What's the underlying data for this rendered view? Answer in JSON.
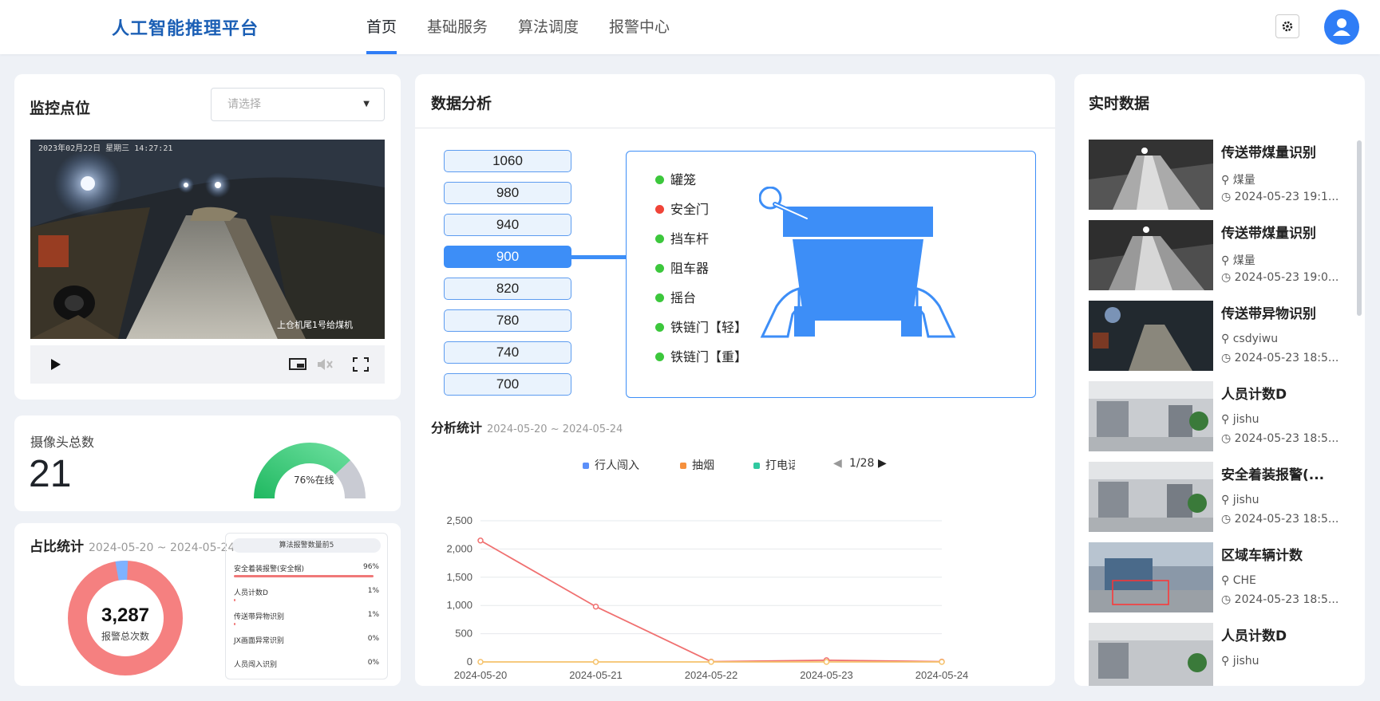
{
  "header": {
    "brand": "人工智能推理平台",
    "nav": [
      "首页",
      "基础服务",
      "算法调度",
      "报警中心"
    ]
  },
  "monitor": {
    "title": "监控点位",
    "select_placeholder": "请选择",
    "video_timestamp": "2023年02月22日 星期三 14:27:21",
    "video_caption": "上仓机尾1号给煤机"
  },
  "camera": {
    "label": "摄像头总数",
    "total": "21",
    "online_percent": 76,
    "online_text": "76%在线"
  },
  "ratio": {
    "title": "占比统计",
    "date_range": "2024-05-20 ~ 2024-05-24",
    "total": "3,287",
    "total_label": "报警总次数",
    "top5_title": "算法报警数量前5",
    "top5": [
      {
        "name": "安全着装报警(安全帽)",
        "pct": "96%",
        "value": 96
      },
      {
        "name": "人员计数D",
        "pct": "1%",
        "value": 1
      },
      {
        "name": "传送带异物识别",
        "pct": "1%",
        "value": 1
      },
      {
        "name": "JX画面异常识别",
        "pct": "0%",
        "value": 0
      },
      {
        "name": "人员闯入识别",
        "pct": "0%",
        "value": 0
      }
    ]
  },
  "analysis": {
    "title": "数据分析",
    "levels": [
      "1060",
      "980",
      "940",
      "900",
      "820",
      "780",
      "740",
      "700"
    ],
    "active_level": "900",
    "statuses": [
      {
        "label": "罐笼",
        "color": "#3cc73c"
      },
      {
        "label": "安全门",
        "color": "#f04438"
      },
      {
        "label": "挡车杆",
        "color": "#3cc73c"
      },
      {
        "label": "阻车器",
        "color": "#3cc73c"
      },
      {
        "label": "摇台",
        "color": "#3cc73c"
      },
      {
        "label": "铁链门【轻】",
        "color": "#3cc73c"
      },
      {
        "label": "铁链门【重】",
        "color": "#3cc73c"
      }
    ],
    "stats_title": "分析统计",
    "stats_range": "2024-05-20 ~ 2024-05-24",
    "legend": [
      {
        "label": "行人闯入",
        "color": "#5b8ff9"
      },
      {
        "label": "抽烟",
        "color": "#f6903d"
      },
      {
        "label": "打电话",
        "color": "#30c9a0"
      }
    ],
    "pager": "1/28"
  },
  "chart_data": {
    "type": "line",
    "categories": [
      "2024-05-20",
      "2024-05-21",
      "2024-05-22",
      "2024-05-23",
      "2024-05-24"
    ],
    "ylim": [
      0,
      2500
    ],
    "yticks": [
      "0",
      "500",
      "1,000",
      "1,500",
      "2,000",
      "2,500"
    ],
    "series": [
      {
        "color": "#f07070",
        "values": [
          2150,
          980,
          5,
          30,
          5
        ]
      },
      {
        "color": "#f5c26b",
        "values": [
          0,
          0,
          0,
          0,
          0
        ]
      }
    ]
  },
  "realtime": {
    "title": "实时数据",
    "items": [
      {
        "title": "传送带煤量识别",
        "loc": "煤量",
        "time": "2024-05-23 19:1..."
      },
      {
        "title": "传送带煤量识别",
        "loc": "煤量",
        "time": "2024-05-23 19:0..."
      },
      {
        "title": "传送带异物识别",
        "loc": "csdyiwu",
        "time": "2024-05-23 18:5..."
      },
      {
        "title": "人员计数D",
        "loc": "jishu",
        "time": "2024-05-23 18:5..."
      },
      {
        "title": "安全着装报警(...",
        "loc": "jishu",
        "time": "2024-05-23 18:5..."
      },
      {
        "title": "区域车辆计数",
        "loc": "CHE",
        "time": "2024-05-23 18:5..."
      },
      {
        "title": "人员计数D",
        "loc": "jishu",
        "time": ""
      }
    ]
  }
}
